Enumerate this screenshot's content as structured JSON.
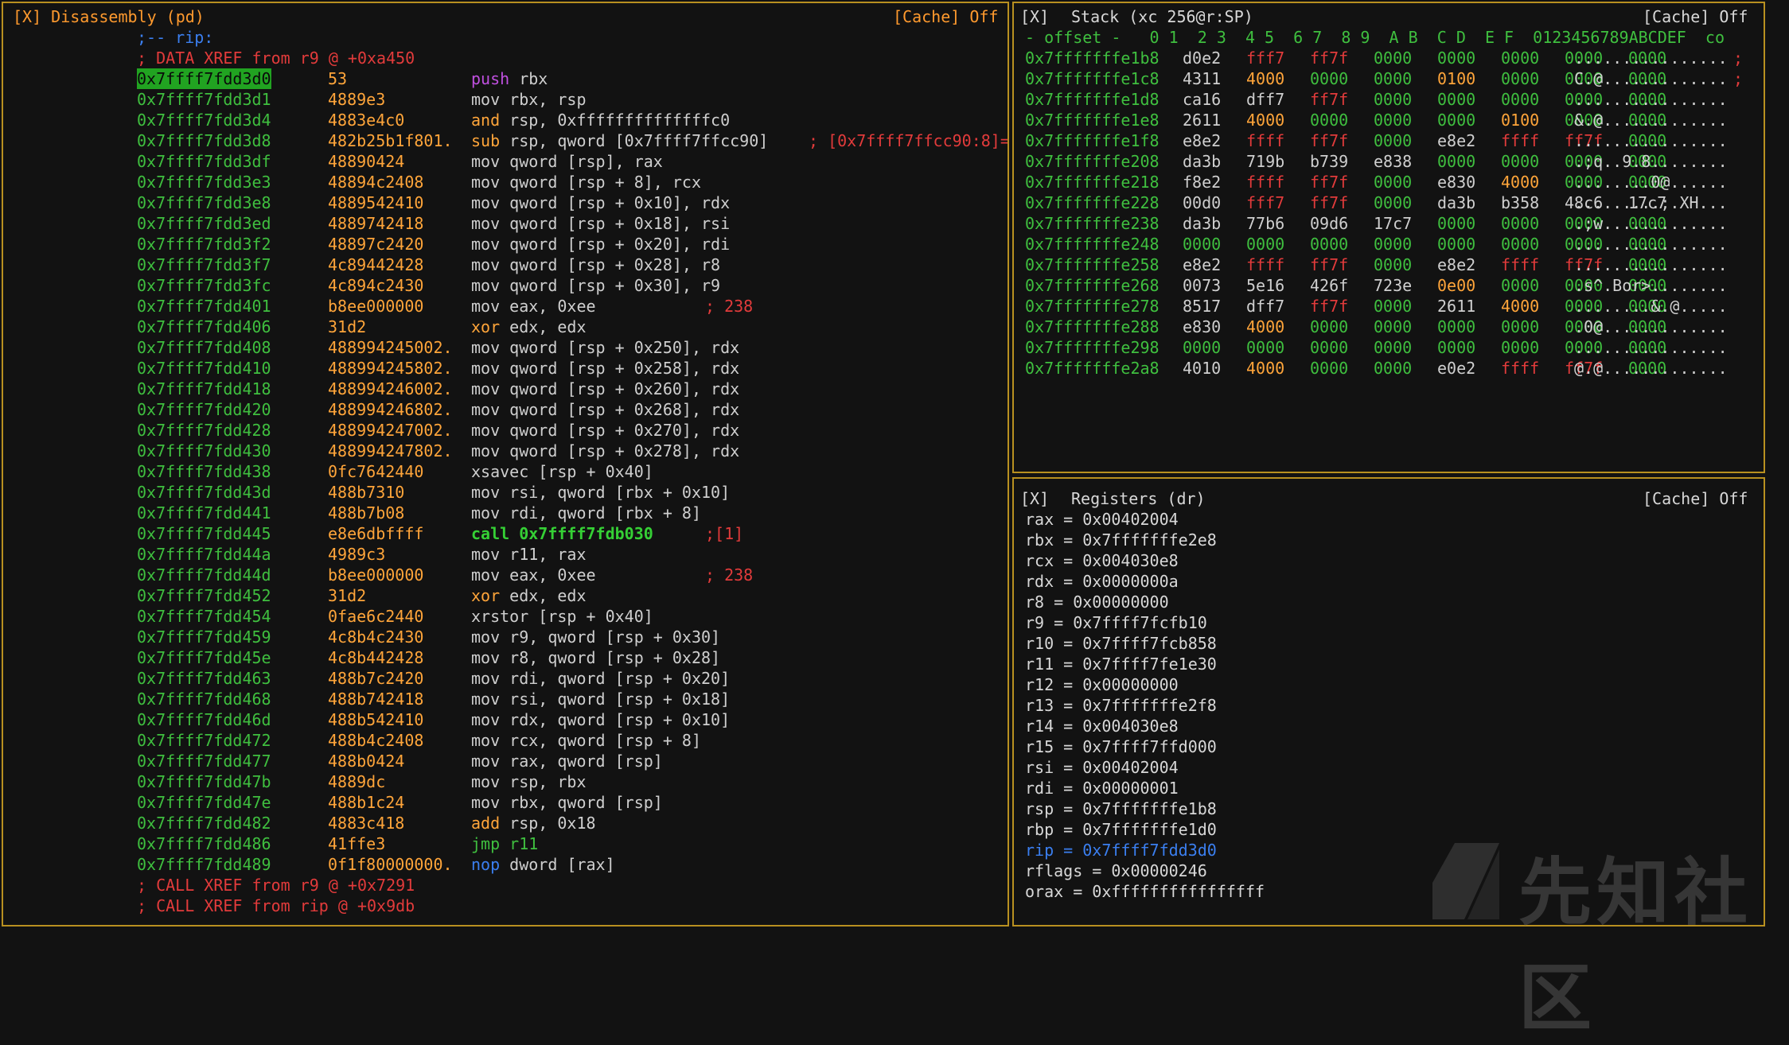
{
  "disasm": {
    "header": "[X] Disassembly (pd)",
    "cache": "[Cache] Off",
    "pre": [
      ";-- rip:",
      "; DATA XREF from r9 @ +0xa450"
    ],
    "rows": [
      {
        "addr": "0x7ffff7fdd3d0",
        "hex": "53",
        "op": "push",
        "args": "rbx"
      },
      {
        "addr": "0x7ffff7fdd3d1",
        "hex": "4889e3",
        "op": "mov",
        "args": "rbx, rsp"
      },
      {
        "addr": "0x7ffff7fdd3d4",
        "hex": "4883e4c0",
        "op": "and",
        "args": "rsp, 0xffffffffffffffc0"
      },
      {
        "addr": "0x7ffff7fdd3d8",
        "hex": "482b25b1f801.",
        "op": "sub",
        "args": "rsp, qword [0x7ffff7ffcc90]",
        "cmt": "; [0x7ffff7ffcc90:8]="
      },
      {
        "addr": "0x7ffff7fdd3df",
        "hex": "48890424",
        "op": "mov",
        "args": "qword [rsp], rax"
      },
      {
        "addr": "0x7ffff7fdd3e3",
        "hex": "48894c2408",
        "op": "mov",
        "args": "qword [rsp + 8], rcx"
      },
      {
        "addr": "0x7ffff7fdd3e8",
        "hex": "4889542410",
        "op": "mov",
        "args": "qword [rsp + 0x10], rdx"
      },
      {
        "addr": "0x7ffff7fdd3ed",
        "hex": "4889742418",
        "op": "mov",
        "args": "qword [rsp + 0x18], rsi"
      },
      {
        "addr": "0x7ffff7fdd3f2",
        "hex": "48897c2420",
        "op": "mov",
        "args": "qword [rsp + 0x20], rdi"
      },
      {
        "addr": "0x7ffff7fdd3f7",
        "hex": "4c89442428",
        "op": "mov",
        "args": "qword [rsp + 0x28], r8"
      },
      {
        "addr": "0x7ffff7fdd3fc",
        "hex": "4c894c2430",
        "op": "mov",
        "args": "qword [rsp + 0x30], r9"
      },
      {
        "addr": "0x7ffff7fdd401",
        "hex": "b8ee000000",
        "op": "mov",
        "args": "eax, 0xee",
        "cmt": "; 238"
      },
      {
        "addr": "0x7ffff7fdd406",
        "hex": "31d2",
        "op": "xor",
        "args": "edx, edx"
      },
      {
        "addr": "0x7ffff7fdd408",
        "hex": "488994245002.",
        "op": "mov",
        "args": "qword [rsp + 0x250], rdx"
      },
      {
        "addr": "0x7ffff7fdd410",
        "hex": "488994245802.",
        "op": "mov",
        "args": "qword [rsp + 0x258], rdx"
      },
      {
        "addr": "0x7ffff7fdd418",
        "hex": "488994246002.",
        "op": "mov",
        "args": "qword [rsp + 0x260], rdx"
      },
      {
        "addr": "0x7ffff7fdd420",
        "hex": "488994246802.",
        "op": "mov",
        "args": "qword [rsp + 0x268], rdx"
      },
      {
        "addr": "0x7ffff7fdd428",
        "hex": "488994247002.",
        "op": "mov",
        "args": "qword [rsp + 0x270], rdx"
      },
      {
        "addr": "0x7ffff7fdd430",
        "hex": "488994247802.",
        "op": "mov",
        "args": "qword [rsp + 0x278], rdx"
      },
      {
        "addr": "0x7ffff7fdd438",
        "hex": "0fc7642440",
        "op": "xsavec",
        "args": "[rsp + 0x40]"
      },
      {
        "addr": "0x7ffff7fdd43d",
        "hex": "488b7310",
        "op": "mov",
        "args": "rsi, qword [rbx + 0x10]"
      },
      {
        "addr": "0x7ffff7fdd441",
        "hex": "488b7b08",
        "op": "mov",
        "args": "rdi, qword [rbx + 8]"
      },
      {
        "addr": "0x7ffff7fdd445",
        "hex": "e8e6dbffff",
        "op": "call",
        "args": "0x7ffff7fdb030",
        "cmt": ";[1]"
      },
      {
        "addr": "0x7ffff7fdd44a",
        "hex": "4989c3",
        "op": "mov",
        "args": "r11, rax"
      },
      {
        "addr": "0x7ffff7fdd44d",
        "hex": "b8ee000000",
        "op": "mov",
        "args": "eax, 0xee",
        "cmt": "; 238"
      },
      {
        "addr": "0x7ffff7fdd452",
        "hex": "31d2",
        "op": "xor",
        "args": "edx, edx"
      },
      {
        "addr": "0x7ffff7fdd454",
        "hex": "0fae6c2440",
        "op": "xrstor",
        "args": "[rsp + 0x40]"
      },
      {
        "addr": "0x7ffff7fdd459",
        "hex": "4c8b4c2430",
        "op": "mov",
        "args": "r9, qword [rsp + 0x30]"
      },
      {
        "addr": "0x7ffff7fdd45e",
        "hex": "4c8b442428",
        "op": "mov",
        "args": "r8, qword [rsp + 0x28]"
      },
      {
        "addr": "0x7ffff7fdd463",
        "hex": "488b7c2420",
        "op": "mov",
        "args": "rdi, qword [rsp + 0x20]"
      },
      {
        "addr": "0x7ffff7fdd468",
        "hex": "488b742418",
        "op": "mov",
        "args": "rsi, qword [rsp + 0x18]"
      },
      {
        "addr": "0x7ffff7fdd46d",
        "hex": "488b542410",
        "op": "mov",
        "args": "rdx, qword [rsp + 0x10]"
      },
      {
        "addr": "0x7ffff7fdd472",
        "hex": "488b4c2408",
        "op": "mov",
        "args": "rcx, qword [rsp + 8]"
      },
      {
        "addr": "0x7ffff7fdd477",
        "hex": "488b0424",
        "op": "mov",
        "args": "rax, qword [rsp]"
      },
      {
        "addr": "0x7ffff7fdd47b",
        "hex": "4889dc",
        "op": "mov",
        "args": "rsp, rbx"
      },
      {
        "addr": "0x7ffff7fdd47e",
        "hex": "488b1c24",
        "op": "mov",
        "args": "rbx, qword [rsp]"
      },
      {
        "addr": "0x7ffff7fdd482",
        "hex": "4883c418",
        "op": "add",
        "args": "rsp, 0x18"
      },
      {
        "addr": "0x7ffff7fdd486",
        "hex": "41ffe3",
        "op": "jmp",
        "args": "r11"
      },
      {
        "addr": "0x7ffff7fdd489",
        "hex": "0f1f80000000.",
        "op": "nop",
        "args": "dword [rax]"
      }
    ],
    "post": [
      "; CALL XREF from r9 @ +0x7291",
      "; CALL XREF from rip @ +0x9db"
    ]
  },
  "stack": {
    "header_x": "[X]",
    "header": "Stack (xc 256@r:SP)",
    "cache": "[Cache] Off",
    "col_header": "- offset -   0 1  2 3  4 5  6 7  8 9  A B  C D  E F  0123456789ABCDEF  co",
    "rows": [
      {
        "off": "0x7fffffffe1b8",
        "w": [
          "d0e2",
          "fff7",
          "ff7f",
          "0000",
          "0000",
          "0000",
          "0000",
          "0000"
        ],
        "a": "................",
        "c": ";"
      },
      {
        "off": "0x7fffffffe1c8",
        "w": [
          "4311",
          "4000",
          "0000",
          "0000",
          "0100",
          "0000",
          "0000",
          "0000"
        ],
        "a": "C.@.............",
        "c": ";"
      },
      {
        "off": "0x7fffffffe1d8",
        "w": [
          "ca16",
          "dff7",
          "ff7f",
          "0000",
          "0000",
          "0000",
          "0000",
          "0000"
        ],
        "a": "................",
        "c": ""
      },
      {
        "off": "0x7fffffffe1e8",
        "w": [
          "2611",
          "4000",
          "0000",
          "0000",
          "0000",
          "0100",
          "0000",
          "0000"
        ],
        "a": "&.@.............",
        "c": ""
      },
      {
        "off": "0x7fffffffe1f8",
        "w": [
          "e8e2",
          "ffff",
          "ff7f",
          "0000",
          "e8e2",
          "ffff",
          "ff7f",
          "0000"
        ],
        "a": "................",
        "c": ""
      },
      {
        "off": "0x7fffffffe208",
        "w": [
          "da3b",
          "719b",
          "b739",
          "e838",
          "0000",
          "0000",
          "0000",
          "0000"
        ],
        "a": ".;q..9.8........",
        "c": ""
      },
      {
        "off": "0x7fffffffe218",
        "w": [
          "f8e2",
          "ffff",
          "ff7f",
          "0000",
          "e830",
          "4000",
          "0000",
          "0000"
        ],
        "a": "........0@......",
        "c": ""
      },
      {
        "off": "0x7fffffffe228",
        "w": [
          "00d0",
          "fff7",
          "ff7f",
          "0000",
          "da3b",
          "b358",
          "48c6",
          "17c7"
        ],
        "a": ".........;.XH...",
        "c": ""
      },
      {
        "off": "0x7fffffffe238",
        "w": [
          "da3b",
          "77b6",
          "09d6",
          "17c7",
          "0000",
          "0000",
          "0000",
          "0000"
        ],
        "a": ".;w.............",
        "c": ""
      },
      {
        "off": "0x7fffffffe248",
        "w": [
          "0000",
          "0000",
          "0000",
          "0000",
          "0000",
          "0000",
          "0000",
          "0000"
        ],
        "a": "................",
        "c": ""
      },
      {
        "off": "0x7fffffffe258",
        "w": [
          "e8e2",
          "ffff",
          "ff7f",
          "0000",
          "e8e2",
          "ffff",
          "ff7f",
          "0000"
        ],
        "a": "................",
        "c": ""
      },
      {
        "off": "0x7fffffffe268",
        "w": [
          "0073",
          "5e16",
          "426f",
          "723e",
          "0e00",
          "0000",
          "0000",
          "0000"
        ],
        "a": ".s^.Bor>........",
        "c": ""
      },
      {
        "off": "0x7fffffffe278",
        "w": [
          "8517",
          "dff7",
          "ff7f",
          "0000",
          "2611",
          "4000",
          "0000",
          "0000"
        ],
        "a": "........&.@.....",
        "c": ""
      },
      {
        "off": "0x7fffffffe288",
        "w": [
          "e830",
          "4000",
          "0000",
          "0000",
          "0000",
          "0000",
          "0000",
          "0000"
        ],
        "a": ".0@.............",
        "c": ""
      },
      {
        "off": "0x7fffffffe298",
        "w": [
          "0000",
          "0000",
          "0000",
          "0000",
          "0000",
          "0000",
          "0000",
          "0000"
        ],
        "a": "................",
        "c": ""
      },
      {
        "off": "0x7fffffffe2a8",
        "w": [
          "4010",
          "4000",
          "0000",
          "0000",
          "e0e2",
          "ffff",
          "ff7f",
          "0000"
        ],
        "a": "@.@.............",
        "c": ""
      }
    ]
  },
  "regs": {
    "header_x": "[X]",
    "header": "Registers (dr)",
    "cache": "[Cache] Off",
    "rows": [
      {
        "name": "rax",
        "val": "0x00402004"
      },
      {
        "name": "rbx",
        "val": "0x7fffffffe2e8"
      },
      {
        "name": "rcx",
        "val": "0x004030e8"
      },
      {
        "name": "rdx",
        "val": "0x0000000a"
      },
      {
        "name": "r8",
        "val": "0x00000000"
      },
      {
        "name": "r9",
        "val": "0x7ffff7fcfb10"
      },
      {
        "name": "r10",
        "val": "0x7ffff7fcb858"
      },
      {
        "name": "r11",
        "val": "0x7ffff7fe1e30"
      },
      {
        "name": "r12",
        "val": "0x00000000"
      },
      {
        "name": "r13",
        "val": "0x7fffffffe2f8"
      },
      {
        "name": "r14",
        "val": "0x004030e8"
      },
      {
        "name": "r15",
        "val": "0x7ffff7ffd000"
      },
      {
        "name": "rsi",
        "val": "0x00402004"
      },
      {
        "name": "rdi",
        "val": "0x00000001"
      },
      {
        "name": "rsp",
        "val": "0x7fffffffe1b8"
      },
      {
        "name": "rbp",
        "val": "0x7fffffffe1d0"
      },
      {
        "name": "rip",
        "val": "0x7ffff7fdd3d0",
        "hl": true
      },
      {
        "name": "rflags",
        "val": "0x00000246"
      },
      {
        "name": "orax",
        "val": "0xffffffffffffffff"
      }
    ]
  },
  "watermark": "先知社区",
  "colors": {
    "frame": "#b89020",
    "addr": "#3fbf3f",
    "comment": "#e23b3b",
    "register": "#3b7ff0",
    "immediate": "#ffa53a"
  }
}
